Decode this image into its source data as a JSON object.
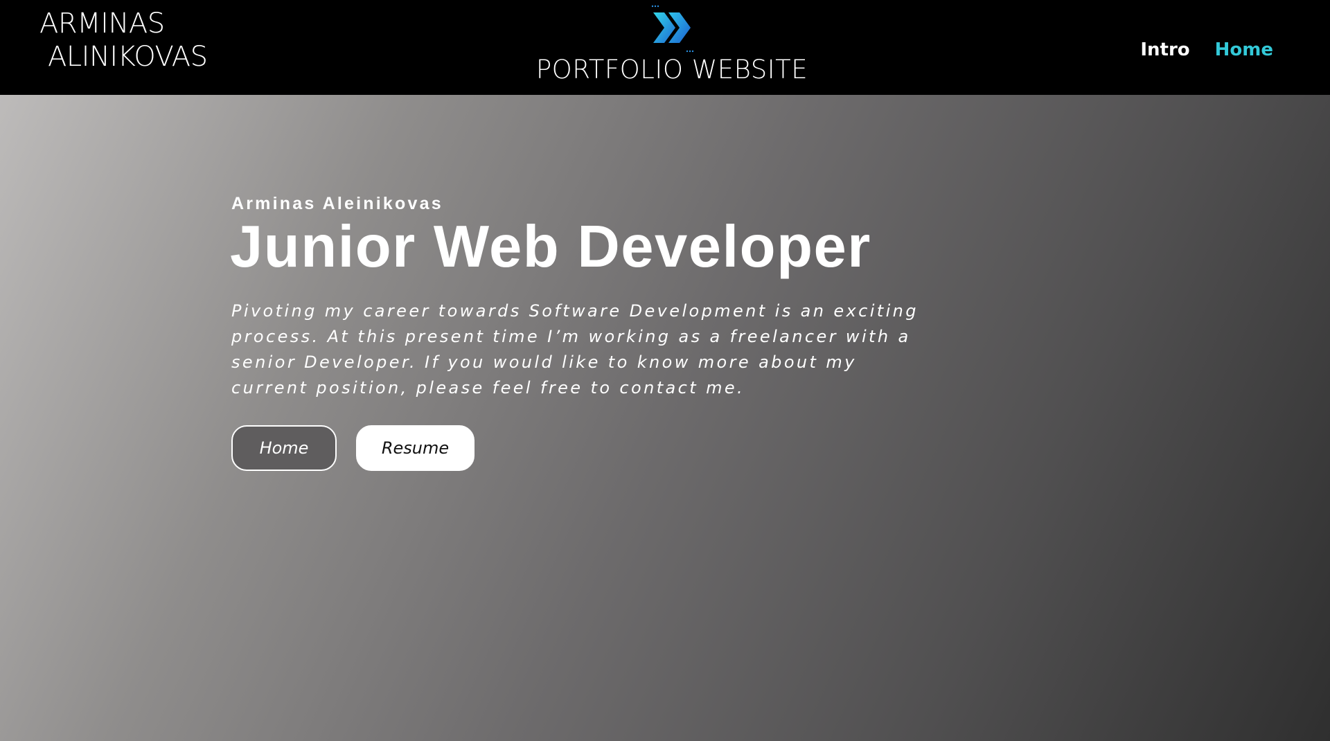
{
  "header": {
    "brand_line1": "ARMINAS",
    "brand_line2": "ALINIKOVAS",
    "logo_icon": "double-chevron-right-icon",
    "logo_title": "PORTFOLIO WEBSITE",
    "nav": {
      "intro": "Intro",
      "home": "Home"
    },
    "colors": {
      "nav_active": "#33c9d8",
      "logo_gradient_start": "#2fd4e6",
      "logo_gradient_end": "#1f6fd6"
    }
  },
  "hero": {
    "name": "Arminas Aleinikovas",
    "title": "Junior Web Developer",
    "description": "Pivoting my career towards Software Development is an exciting process. At this present time I’m working as a freelancer with a senior Developer. If you would like to know more about my current position, please feel free to contact me.",
    "buttons": {
      "home": "Home",
      "resume": "Resume"
    }
  }
}
